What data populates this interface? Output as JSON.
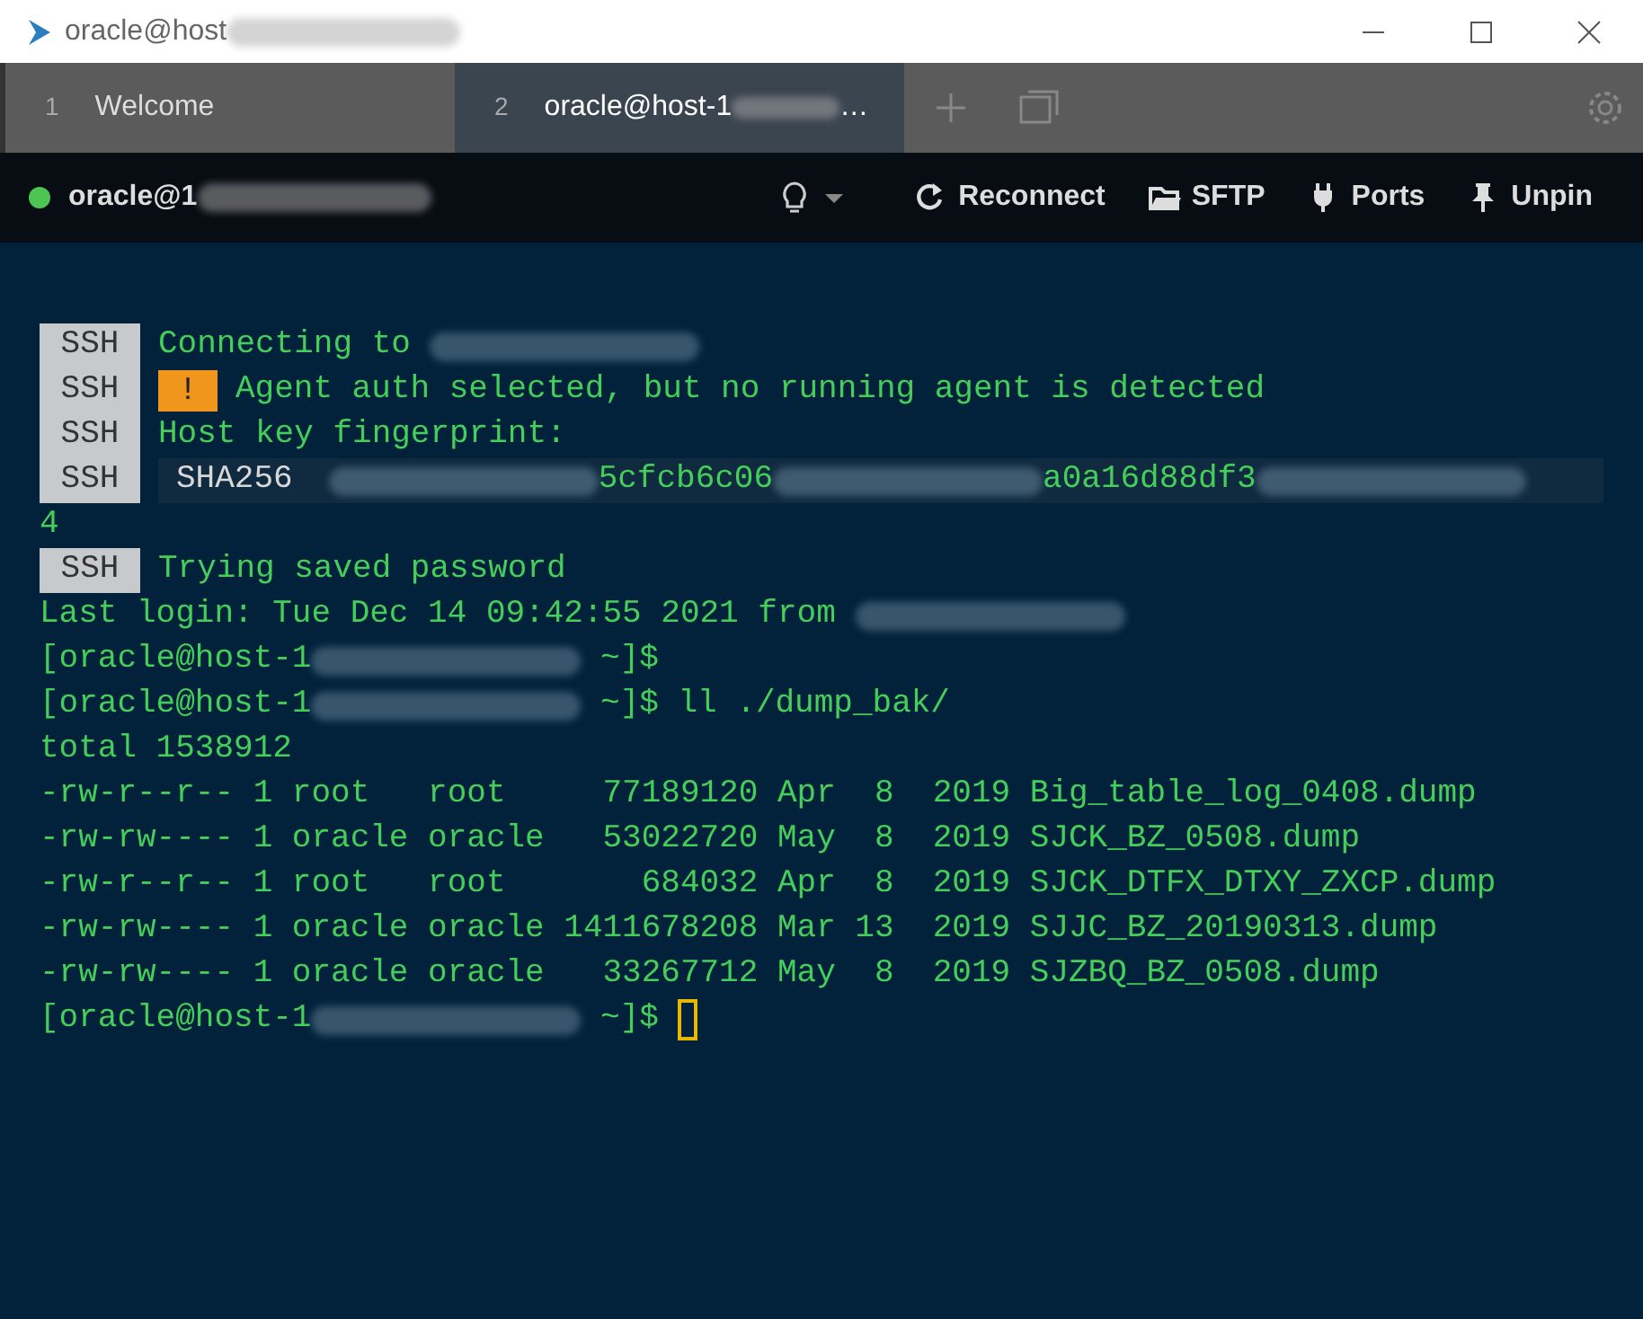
{
  "window": {
    "title": "oracle@host",
    "title_redacted": true
  },
  "tabs": [
    {
      "number": "1",
      "label": "Welcome",
      "selected": false
    },
    {
      "number": "2",
      "label": "oracle@host-1",
      "label_redacted": true,
      "label_end": "…",
      "selected": true
    }
  ],
  "toolbar": {
    "connected": true,
    "host": "oracle@1",
    "host_redacted": true,
    "buttons": [
      {
        "kind": "reconnect",
        "label": "Reconnect"
      },
      {
        "kind": "sftp",
        "label": "SFTP"
      },
      {
        "kind": "ports",
        "label": "Ports"
      },
      {
        "kind": "unpin",
        "label": "Unpin"
      }
    ]
  },
  "terminal": {
    "lines": [
      {
        "badge": "SSH",
        "parts": [
          {
            "kind": "text",
            "text": "Connecting to "
          },
          {
            "kind": "blur"
          }
        ]
      },
      {
        "badge": "SSH",
        "warning": "!",
        "parts": [
          {
            "kind": "text",
            "text": "Agent auth selected, but no running agent is detected"
          }
        ]
      },
      {
        "badge": "SSH",
        "parts": [
          {
            "kind": "text",
            "text": "Host key fingerprint:"
          }
        ]
      },
      {
        "badge": "SSH",
        "key": "SHA256",
        "parts": [
          {
            "kind": "blur"
          },
          {
            "kind": "text",
            "text": "5cfcb6c06"
          },
          {
            "kind": "blur"
          },
          {
            "kind": "text",
            "text": "a0a16d88df3"
          },
          {
            "kind": "blur"
          }
        ]
      },
      {
        "parts": [
          {
            "kind": "text",
            "text": "4"
          }
        ]
      },
      {
        "badge": "SSH",
        "parts": [
          {
            "kind": "text",
            "text": "Trying saved password"
          }
        ]
      },
      {
        "parts": [
          {
            "kind": "text",
            "text": "Last login: Tue Dec 14 09:42:55 2021 from "
          },
          {
            "kind": "blur"
          }
        ]
      },
      {
        "parts": [
          {
            "kind": "text",
            "text": "[oracle@host-1"
          },
          {
            "kind": "blur"
          },
          {
            "kind": "text",
            "text": " ~]$"
          }
        ]
      },
      {
        "parts": [
          {
            "kind": "text",
            "text": "[oracle@host-1"
          },
          {
            "kind": "blur"
          },
          {
            "kind": "text",
            "text": " ~]$ ll ./dump_bak/"
          }
        ]
      },
      {
        "parts": [
          {
            "kind": "text",
            "text": "total 1538912"
          }
        ]
      },
      {
        "parts": [
          {
            "kind": "text",
            "text": "-rw-r--r-- 1 root   root     77189120 Apr  8  2019 Big_table_log_0408.dump"
          }
        ]
      },
      {
        "parts": [
          {
            "kind": "text",
            "text": "-rw-rw---- 1 oracle oracle   53022720 May  8  2019 SJCK_BZ_0508.dump"
          }
        ]
      },
      {
        "parts": [
          {
            "kind": "text",
            "text": "-rw-r--r-- 1 root   root       684032 Apr  8  2019 SJCK_DTFX_DTXY_ZXCP.dump"
          }
        ]
      },
      {
        "parts": [
          {
            "kind": "text",
            "text": "-rw-rw---- 1 oracle oracle 1411678208 Mar 13  2019 SJJC_BZ_20190313.dump"
          }
        ]
      },
      {
        "parts": [
          {
            "kind": "text",
            "text": "-rw-rw---- 1 oracle oracle   33267712 May  8  2019 SJZBQ_BZ_0508.dump"
          }
        ]
      },
      {
        "parts": [
          {
            "kind": "text",
            "text": "[oracle@host-1"
          },
          {
            "kind": "blur"
          },
          {
            "kind": "text",
            "text": " ~]$ "
          },
          {
            "kind": "cursor"
          }
        ]
      }
    ]
  }
}
